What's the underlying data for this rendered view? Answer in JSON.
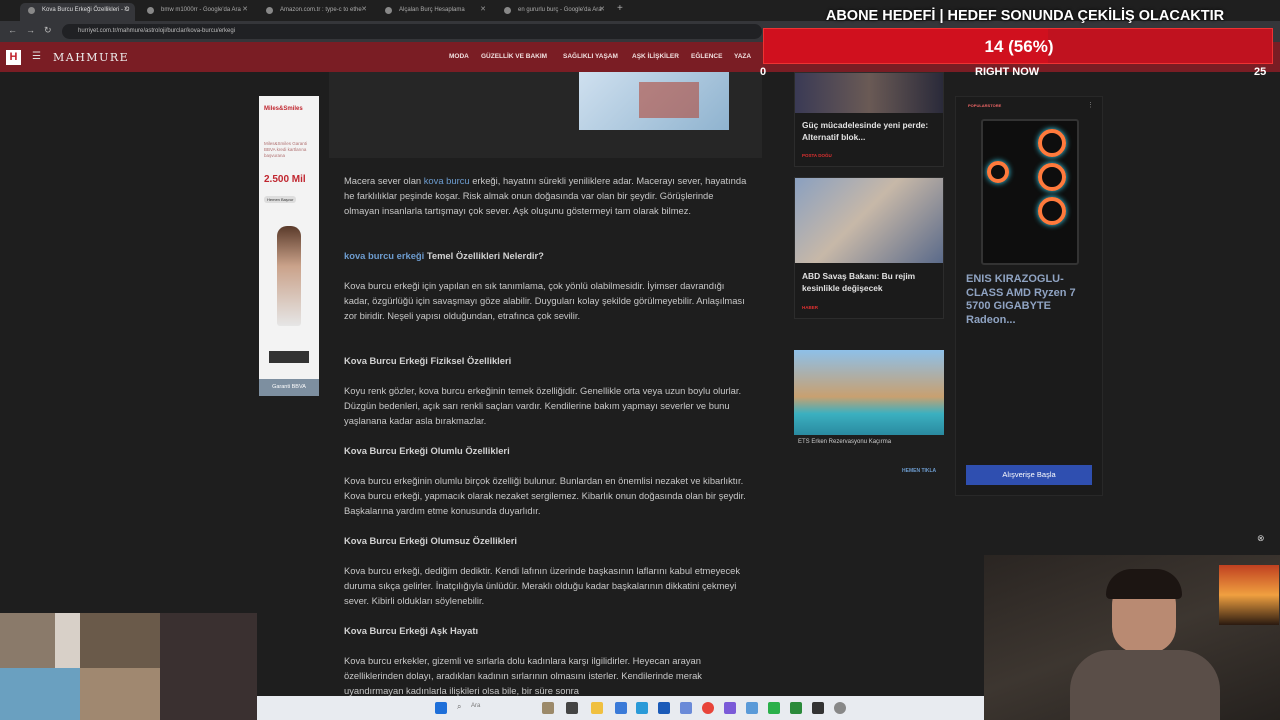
{
  "browser": {
    "tabs": [
      {
        "label": "Kova Burcu Erkeği Özellikleri - O",
        "active": true
      },
      {
        "label": "bmw m1000rr - Google'da Ara",
        "active": false
      },
      {
        "label": "Amazon.com.tr : type-c to ethe",
        "active": false
      },
      {
        "label": "Alçalan Burç Hesaplama",
        "active": false
      },
      {
        "label": "en gururlu burç - Google'da Ara",
        "active": false
      }
    ],
    "url": "hurriyet.com.tr/mahmure/astroloji/burclar/kova-burcu/erkegi"
  },
  "site": {
    "logo_letter": "H",
    "brand": "MAHMURE",
    "nav": [
      "MODA",
      "GÜZELLİK VE BAKIM",
      "SAĞLIKLI YAŞAM",
      "AŞK İLİŞKİLER",
      "EĞLENCE",
      "YAZA"
    ]
  },
  "article": {
    "intro_prefix": "Macera sever olan ",
    "intro_link": "kova burcu",
    "intro_rest": " erkeği, hayatını sürekli yeniliklere adar. Macerayı sever, hayatında he farklılıklar peşinde koşar. Risk almak onun doğasında var olan bir şeydir. Görüşlerinde olmayan insanlarla tartışmayı çok sever. Aşk oluşunu göstermeyi tam olarak bilmez.",
    "h1_link": "kova burcu erkeği",
    "h1_rest": " Temel Özellikleri Nelerdir?",
    "p1": "Kova burcu erkeği için yapılan en sık tanımlama, çok yönlü olabilmesidir. İyimser davrandığı kadar, özgürlüğü için savaşmayı göze alabilir. Duyguları kolay şekilde görülmeyebilir. Anlaşılması zor biridir. Neşeli yapısı olduğundan, etrafınca çok sevilir.",
    "h2": "Kova Burcu Erkeği Fiziksel Özellikleri",
    "p2": "Koyu renk gözler, kova burcu erkeğinin temek özelliğidir. Genellikle orta veya uzun boylu olurlar. Düzgün bedenleri, açık sarı renkli saçları vardır. Kendilerine bakım yapmayı severler ve bunu yaşlanana kadar asla bırakmazlar.",
    "h3": "Kova Burcu Erkeği Olumlu Özellikleri",
    "p3": "Kova burcu erkeğinin olumlu birçok özelliği bulunur. Bunlardan en önemlisi nezaket ve kibarlıktır. Kova burcu erkeği, yapmacık olarak nezaket sergilemez. Kibarlık onun doğasında olan bir şeydir. Başkalarına yardım etme konusunda duyarlıdır.",
    "h4": "Kova Burcu Erkeği Olumsuz Özellikleri",
    "p4": "Kova burcu erkeği, dediğim dediktir. Kendi lafının üzerinde başkasının laflarını kabul etmeyecek duruma sıkça gelirler. İnatçılığıyla ünlüdür. Meraklı olduğu kadar başkalarının dikkatini çekmeyi sever. Kibirli oldukları söylenebilir.",
    "h5": "Kova Burcu Erkeği Aşk Hayatı",
    "p5": "Kova burcu erkekler, gizemli ve sırlarla dolu kadınlara karşı ilgilidirler. Heyecan arayan özelliklerinden dolayı, aradıkları kadının sırlarının olmasını isterler. Kendilerinde merak uyandırmayan kadınlarla ilişkileri olsa bile, bir süre sonra"
  },
  "left_ad": {
    "brand": "Miles&Smiles",
    "line": "Miles&Smiles Garanti BBVA kredi kartlarına başvurana",
    "amount": "2.500 Mil",
    "cta": "Hemen Başvur",
    "bank": "Garanti BBVA"
  },
  "sidebar": {
    "cards": [
      {
        "title": "Güç mücadelesinde yeni perde: Alternatif blok...",
        "tag": "POSTA DOĞU"
      },
      {
        "title": "ABD Savaş Bakanı: Bu rejim kesinlikle değişecek",
        "tag": "HABER"
      },
      {
        "title": "ETS Erken Rezervasyonu Kaçırma",
        "tag": "HEMEN TIKLA"
      }
    ]
  },
  "product": {
    "store": "POPULARSTORE",
    "title": "ENIS KIRAZOGLU-CLASS AMD Ryzen 7 5700 GIGABYTE Radeon...",
    "button": "Alışverişe Başla"
  },
  "goal": {
    "title": "ABONE HEDEFİ | HEDEF SONUNDA ÇEKİLİŞ OLACAKTIR",
    "count_text": "14 (56%)",
    "progress": 0.56,
    "min": "0",
    "now": "RIGHT NOW",
    "max": "25"
  },
  "taskbar": {
    "search": "Ara"
  },
  "colors": {
    "site_header": "#7a1d24",
    "goal_bar": "#c0121f",
    "link": "#6d9ccf",
    "product_button": "#2f4fb0"
  }
}
